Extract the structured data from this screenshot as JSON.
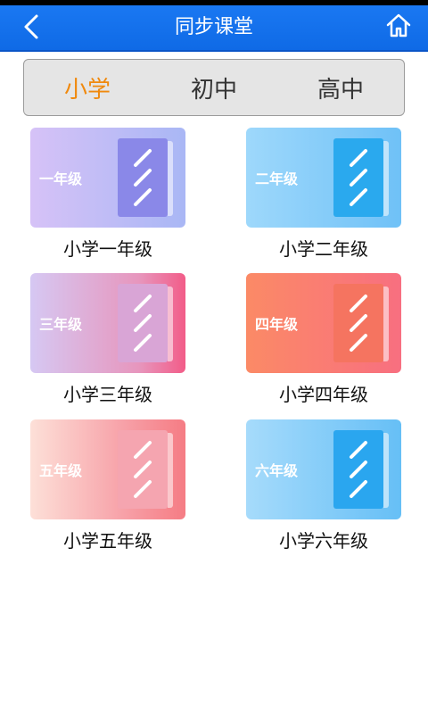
{
  "header": {
    "title": "同步课堂",
    "back_icon": "chevron-left-icon",
    "home_icon": "home-icon"
  },
  "tabs": [
    {
      "label": "小学",
      "active": true
    },
    {
      "label": "初中",
      "active": false
    },
    {
      "label": "高中",
      "active": false
    }
  ],
  "grades": [
    {
      "card_label": "一年级",
      "caption": "小学一年级"
    },
    {
      "card_label": "二年级",
      "caption": "小学二年级"
    },
    {
      "card_label": "三年级",
      "caption": "小学三年级"
    },
    {
      "card_label": "四年级",
      "caption": "小学四年级"
    },
    {
      "card_label": "五年级",
      "caption": "小学五年级"
    },
    {
      "card_label": "六年级",
      "caption": "小学六年级"
    }
  ],
  "colors": {
    "header_bg": "#1a78f2",
    "active_tab": "#f0890d"
  }
}
